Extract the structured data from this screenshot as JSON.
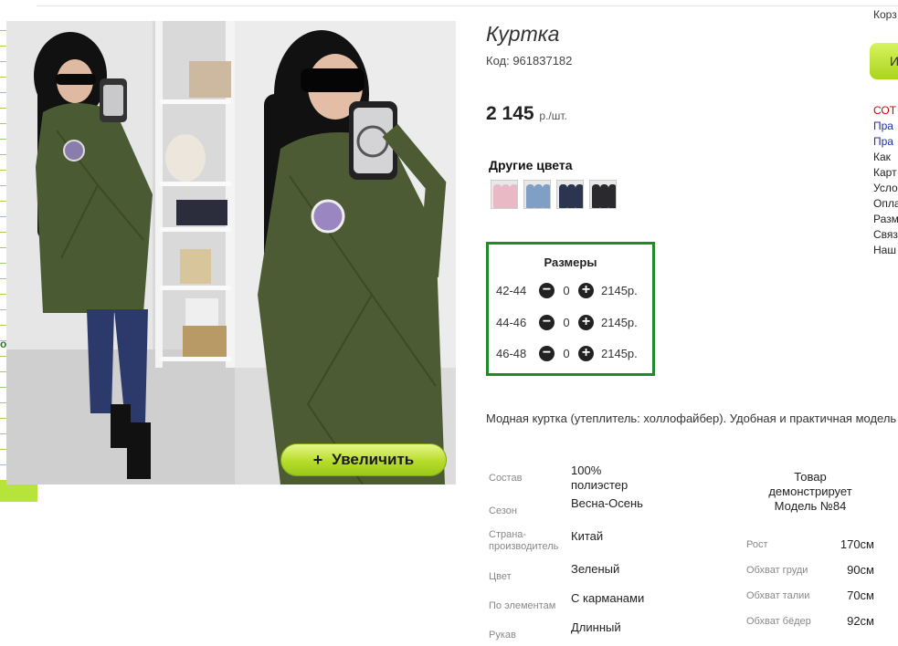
{
  "product": {
    "title": "Куртка",
    "code": "Код: 961837182",
    "price_value": "2 145",
    "price_unit": "р./шт."
  },
  "gallery": {
    "zoom_label": "Увеличить",
    "zoom_icon": "+"
  },
  "other_colors": {
    "heading": "Другие цвета",
    "swatches": [
      {
        "name": "pink",
        "color": "#e9b9c6"
      },
      {
        "name": "blue",
        "color": "#7f9fc4"
      },
      {
        "name": "navy",
        "color": "#2b3550"
      },
      {
        "name": "black",
        "color": "#2a2a2e"
      }
    ]
  },
  "sizes": {
    "heading": "Размеры",
    "minus_icon": "−",
    "plus_icon": "+",
    "rows": [
      {
        "size": "42-44",
        "qty": "0",
        "price": "2145р."
      },
      {
        "size": "44-46",
        "qty": "0",
        "price": "2145р."
      },
      {
        "size": "46-48",
        "qty": "0",
        "price": "2145р."
      }
    ]
  },
  "description": "Модная куртка (утеплитель: холлофайбер). Удобная и практичная модель",
  "properties": [
    {
      "key": "Состав",
      "value": "100% полиэстер"
    },
    {
      "key": "Сезон",
      "value": "Весна-Осень"
    },
    {
      "key": "Страна-производитель",
      "value": "Китай"
    },
    {
      "key": "Цвет",
      "value": "Зеленый"
    },
    {
      "key": "По элементам",
      "value": "С карманами"
    },
    {
      "key": "Рукав",
      "value": "Длинный"
    }
  ],
  "model": {
    "heading": "Товар демонстрирует Модель №84",
    "measurements": [
      {
        "key": "Рост",
        "value": "170см"
      },
      {
        "key": "Обхват груди",
        "value": "90см"
      },
      {
        "key": "Обхват талии",
        "value": "70см"
      },
      {
        "key": "Обхват бёдер",
        "value": "92см"
      }
    ]
  },
  "sidebar": {
    "cart": "Корз",
    "button": "И",
    "links": [
      {
        "text": "СОТ",
        "color": "#d00000"
      },
      {
        "text": "Пра",
        "color": "#1a2fa8"
      },
      {
        "text": "Пра",
        "color": "#1a2fa8"
      },
      {
        "text": "Как",
        "color": "#222222"
      },
      {
        "text": "Карт",
        "color": "#222222"
      },
      {
        "text": "Усло",
        "color": "#222222"
      },
      {
        "text": "Опла",
        "color": "#222222"
      },
      {
        "text": "Разм",
        "color": "#222222"
      },
      {
        "text": "Связ",
        "color": "#222222"
      },
      {
        "text": "Наш",
        "color": "#222222"
      }
    ]
  },
  "left_edge": {
    "letter": "o"
  },
  "colors": {
    "accent_green": "#1e8a2a",
    "button_green": "#b6dc2a",
    "jacket": "#4a5a32"
  }
}
